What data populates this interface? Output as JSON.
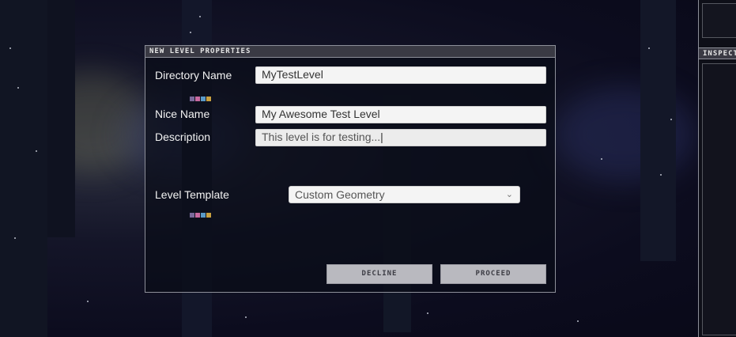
{
  "dialog": {
    "title": "NEW LEVEL PROPERTIES",
    "fields": {
      "directory_name": {
        "label": "Directory Name",
        "value": "MyTestLevel"
      },
      "nice_name": {
        "label": "Nice Name",
        "value": "My Awesome Test Level"
      },
      "description": {
        "label": "Description",
        "value": "This level is for testing..."
      },
      "level_template": {
        "label": "Level Template",
        "selected": "Custom Geometry"
      }
    },
    "buttons": {
      "decline": "DECLINE",
      "proceed": "PROCEED"
    }
  },
  "inspector": {
    "title": "INSPECTOR"
  },
  "colors": {
    "dialog_border": "#8d8f99",
    "title_bar": "#3a3a44",
    "button_bg": "#b9b9bf"
  },
  "icons": {
    "chevron": "chevron-down-icon",
    "sprite": "pixel-sprite-icon"
  }
}
